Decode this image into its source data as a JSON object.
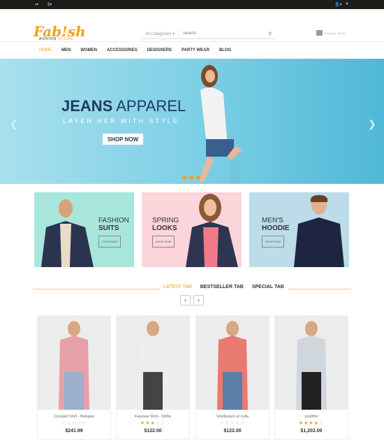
{
  "topbar": {
    "language": "▪▾",
    "currency": "$▾",
    "account": "👤▾",
    "wishlist": "♥"
  },
  "header": {
    "logo_main": "Fab!sh",
    "logo_sub1": "ASHION",
    "logo_sub2": "STORE",
    "category": "All Categories",
    "search_placeholder": "Search",
    "cart": "0 item(s) - $0.00"
  },
  "nav": [
    "HOME",
    "MEN",
    "WOMEN",
    "ACCESSORIES",
    "DESIGNERS",
    "PARTY WEAR",
    "BLOG"
  ],
  "hero": {
    "title_bold": "JEANS",
    "title_light": " APPAREL",
    "subtitle": "LAYER HER WITH STYLE",
    "button": "SHOP NOW"
  },
  "banners": [
    {
      "line1": "FASHION",
      "line2": "SUITS",
      "button": "SHOP NOW",
      "bg": "#a8e6dc"
    },
    {
      "line1": "SPRING",
      "line2": "LOOKS",
      "button": "SHOP NOW",
      "bg": "#fbd5da"
    },
    {
      "line1": "MEN'S",
      "line2": "HOODIE",
      "button": "SHOP NOW",
      "bg": "#bcdcea"
    }
  ],
  "tabs": [
    "LATEST TAB",
    "BESTSELLER TAB",
    "SPECIAL TAB"
  ],
  "products": [
    {
      "name": "Crossed Shirt - Belugas",
      "rating": 0,
      "price": "$241.99"
    },
    {
      "name": "Fauxwai Shirt - Oldbs",
      "rating": 3,
      "price": "$122.00"
    },
    {
      "name": "Vestibulum ut nulla",
      "rating": 0,
      "price": "$122.00"
    },
    {
      "name": "youthful",
      "rating": 4,
      "price": "$1,202.00"
    }
  ],
  "colors": {
    "accent": "#f0a020",
    "topbar": "#1e1c18",
    "hero_title": "#1e3a5f"
  }
}
